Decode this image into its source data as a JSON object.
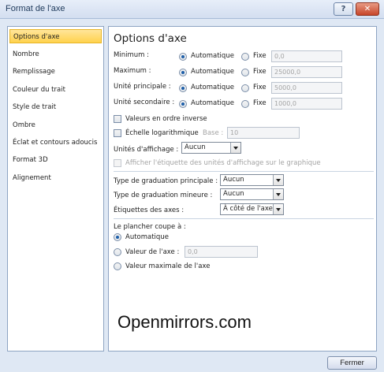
{
  "window": {
    "title": "Format de l'axe",
    "help_glyph": "?",
    "close_glyph": "✕",
    "close_button_label": "Fermer"
  },
  "sidebar": {
    "items": [
      {
        "label": "Options d'axe",
        "selected": true
      },
      {
        "label": "Nombre"
      },
      {
        "label": "Remplissage"
      },
      {
        "label": "Couleur du trait"
      },
      {
        "label": "Style de trait"
      },
      {
        "label": "Ombre"
      },
      {
        "label": "Éclat et contours adoucis"
      },
      {
        "label": "Format 3D"
      },
      {
        "label": "Alignement"
      }
    ]
  },
  "panel": {
    "title": "Options d'axe",
    "rows": [
      {
        "label": "Minimum :",
        "auto": "Automatique",
        "fixed": "Fixe",
        "value": "0,0"
      },
      {
        "label": "Maximum :",
        "auto": "Automatique",
        "fixed": "Fixe",
        "value": "25000,0"
      },
      {
        "label": "Unité principale :",
        "auto": "Automatique",
        "fixed": "Fixe",
        "value": "5000,0"
      },
      {
        "label": "Unité secondaire :",
        "auto": "Automatique",
        "fixed": "Fixe",
        "value": "1000,0"
      }
    ],
    "reverse_order": "Valeurs en ordre inverse",
    "log_scale": "Échelle logarithmique",
    "base_label": "Base :",
    "base_value": "10",
    "display_units_label": "Unités d'affichage :",
    "display_units_value": "Aucun",
    "show_units_label": "Afficher l'étiquette des unités d'affichage sur le graphique",
    "major_tick_label": "Type de graduation principale :",
    "major_tick_value": "Aucun",
    "minor_tick_label": "Type de graduation mineure :",
    "minor_tick_value": "Aucun",
    "axis_labels_label": "Étiquettes des axes :",
    "axis_labels_value": "À côté de l'axe",
    "floor_crosses_label": "Le plancher coupe à :",
    "floor_auto": "Automatique",
    "floor_value_label": "Valeur de l'axe :",
    "floor_value": "0,0",
    "floor_max": "Valeur maximale de l'axe",
    "watermark": "Openmirrors.com"
  }
}
